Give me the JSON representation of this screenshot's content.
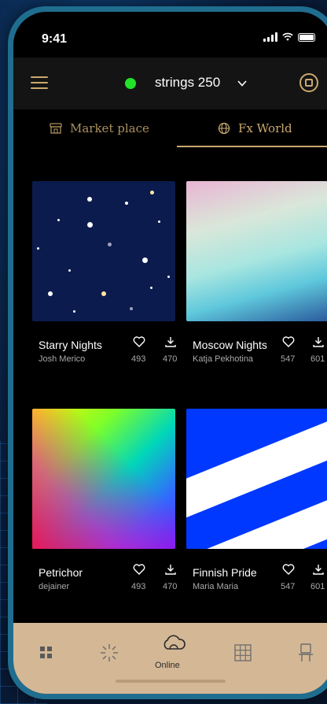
{
  "status_bar": {
    "time": "9:41"
  },
  "header": {
    "device_name": "strings 250",
    "device_status_color": "#22e32a"
  },
  "tabs": [
    {
      "label": "Market place",
      "icon": "store-icon",
      "active": false
    },
    {
      "label": "Fx World",
      "icon": "globe-icon",
      "active": true
    }
  ],
  "cards": [
    {
      "title": "Starry Nights",
      "author": "Josh Merico",
      "likes": "493",
      "downloads": "470"
    },
    {
      "title": "Moscow Nights",
      "author": "Katja Pekhotina",
      "likes": "547",
      "downloads": "601"
    },
    {
      "title": "Petrichor",
      "author": "dejainer",
      "likes": "493",
      "downloads": "470"
    },
    {
      "title": "Finnish Pride",
      "author": "Maria Maria",
      "likes": "547",
      "downloads": "601"
    }
  ],
  "bottom_nav": {
    "items": [
      {
        "icon": "grid-icon"
      },
      {
        "icon": "sparkle-icon"
      },
      {
        "icon": "cloud-icon",
        "label": "Online",
        "active": true
      },
      {
        "icon": "matrix-icon"
      },
      {
        "icon": "chair-icon"
      }
    ]
  },
  "colors": {
    "accent": "#c9a96e",
    "nav_bg": "#d4b896"
  }
}
